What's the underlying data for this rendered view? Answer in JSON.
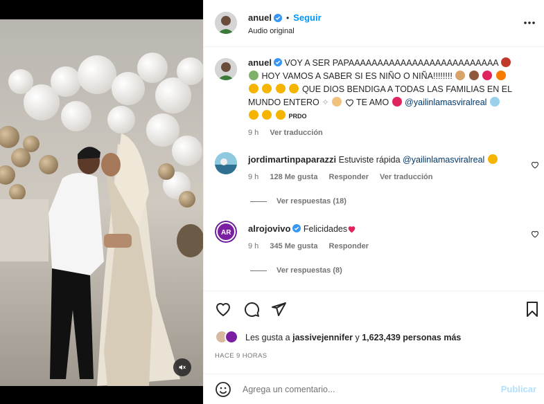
{
  "post": {
    "username": "anuel",
    "follow_label": "Seguir",
    "separator": "•",
    "audio_label": "Audio original"
  },
  "caption": {
    "username": "anuel",
    "line1": "VOY A SER PAPAAAAAAAAAAAAAAAAAAAAAAAAAA",
    "line2": "HOY VAMOS A SABER SI ES NIÑO O NIÑA!!!!!!!!",
    "line3": "QUE DIOS BENDIGA A TODAS LAS FAMILIAS EN EL",
    "line4": "MUNDO ENTERO",
    "line4b": "TE AMO",
    "mention": "@yailinlamasviralreal",
    "pardo": "PRDO",
    "time": "9 h",
    "translate": "Ver traducción"
  },
  "comments": [
    {
      "username": "jordimartinpaparazzi",
      "text": "Estuviste rápida",
      "mention": "@yailinlamasviralreal",
      "time": "9 h",
      "likes": "128 Me gusta",
      "reply": "Responder",
      "translate": "Ver traducción",
      "view_replies": "Ver respuestas (18)"
    },
    {
      "username": "alrojovivo",
      "text": "Felicidades",
      "time": "9 h",
      "likes": "345 Me gusta",
      "reply": "Responder",
      "view_replies": "Ver respuestas (8)"
    }
  ],
  "likes": {
    "prefix": "Les gusta a",
    "user": "jassivejennifer",
    "middle": "y",
    "count": "1,623,439 personas más"
  },
  "timestamp": "HACE 9 HORAS",
  "add_comment": {
    "placeholder": "Agrega un comentario...",
    "post_label": "Publicar"
  },
  "colors": {
    "link_blue": "#0095f6",
    "verified_blue": "#3897f0",
    "post_disabled": "#b2dffc",
    "text": "#262626",
    "muted": "#737373"
  },
  "icons": [
    "verified-icon",
    "more-options-icon",
    "heart-icon",
    "comment-icon",
    "share-icon",
    "bookmark-icon",
    "emoji-icon",
    "mute-icon"
  ]
}
